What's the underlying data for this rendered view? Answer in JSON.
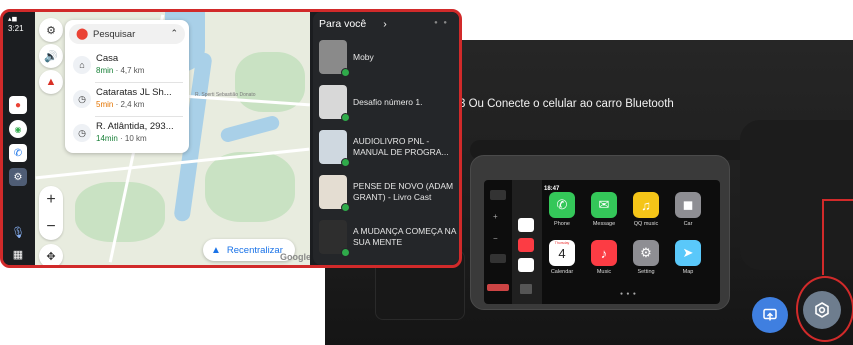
{
  "status": {
    "time": "3:21"
  },
  "search": {
    "placeholder": "Pesquisar"
  },
  "destinations": [
    {
      "name": "Casa",
      "time": "8min",
      "distance": "· 4,7 km",
      "icon": "home-icon"
    },
    {
      "name": "Cataratas JL Sh...",
      "time": "5min",
      "distance": "· 2,4 km",
      "icon": "clock-icon"
    },
    {
      "name": "R. Atlântida, 293...",
      "time": "14min",
      "distance": "· 10 km",
      "icon": "clock-icon"
    }
  ],
  "map": {
    "recenter_label": "Recentralizar",
    "watermark": "Google",
    "street": "R. Sperti Sebastião Donato"
  },
  "media": {
    "header": "Para você",
    "items": [
      {
        "title": "Moby",
        "thumb_color": "#8a8a8a"
      },
      {
        "title": "Desafio número 1.",
        "thumb_color": "#d8d8d8"
      },
      {
        "title": "AUDIOLIVRO PNL - MANUAL DE PROGRA...",
        "thumb_color": "#cfd8e0"
      },
      {
        "title": "PENSE DE NOVO (ADAM GRANT) - Livro Cast",
        "thumb_color": "#e4ddd2"
      },
      {
        "title": "A MUDANÇA COMEÇA NA SUA MENTE",
        "thumb_color": "#2e2e2e"
      }
    ]
  },
  "photo": {
    "caption": "3  Ou Conecte o celular ao carro Bluetooth",
    "car_time": "18:47",
    "apps": [
      {
        "label": "Phone",
        "color": "#34c759",
        "glyph": "✆"
      },
      {
        "label": "Message",
        "color": "#34c759",
        "glyph": "✉"
      },
      {
        "label": "QQ music",
        "color": "#f5c518",
        "glyph": "♫"
      },
      {
        "label": "Car",
        "color": "#8e8e93",
        "glyph": "◼"
      },
      {
        "label": "Calendar",
        "color": "#ffffff",
        "glyph": "4"
      },
      {
        "label": "Music",
        "color": "#fc3c44",
        "glyph": "♪"
      },
      {
        "label": "Setting",
        "color": "#8e8e93",
        "glyph": "⚙"
      },
      {
        "label": "Map",
        "color": "#5ac8fa",
        "glyph": "➤"
      }
    ],
    "calendar_day": "Thursday"
  },
  "colors": {
    "highlight": "#d12a2a",
    "accent": "#1a73e8",
    "eta_green": "#188038",
    "eta_orange": "#e37400"
  }
}
